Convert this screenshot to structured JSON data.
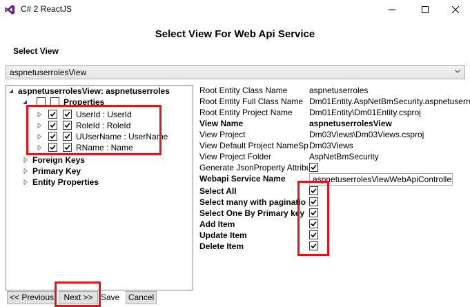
{
  "window": {
    "title": "C# 2 ReactJS",
    "minimize_icon": "minimize-icon",
    "maximize_icon": "maximize-icon",
    "close_icon": "close-icon"
  },
  "heading": "Select View For Web Api Service",
  "select_view": {
    "label": "Select View",
    "selected": "aspnetuserrolesView"
  },
  "tree": {
    "root_label": "aspnetuserrolesView: aspnetuserroles",
    "properties_label": "Properties",
    "properties_checked": false,
    "items": [
      {
        "label": "UserId : UserId",
        "checked": true
      },
      {
        "label": "RoleId : RoleId",
        "checked": true
      },
      {
        "label": "UUserName : UserName",
        "checked": true
      },
      {
        "label": "RName : Name",
        "checked": true
      }
    ],
    "groups": [
      "Foreign Keys",
      "Primary Key",
      "Entity Properties"
    ]
  },
  "details": {
    "root_entity_class_name": {
      "label": "Root Entity Class Name",
      "value": "aspnetuserroles"
    },
    "root_entity_full_class_name": {
      "label": "Root Entity Full Class Name",
      "value": "Dm01Entity.AspNetBmSecurity.aspnetuserro"
    },
    "root_entity_project_name": {
      "label": "Root Entity Project Name",
      "value": "Dm01Entity\\Dm01Entity.csproj"
    },
    "view_name": {
      "label": "View Name",
      "value": "aspnetuserrolesView"
    },
    "view_project": {
      "label": "View Project",
      "value": "Dm03Views\\Dm03Views.csproj"
    },
    "view_default_project_namespace": {
      "label": "View Default Project NameSpa",
      "value": "Dm03Views"
    },
    "view_project_folder": {
      "label": "View Project Folder",
      "value": "AspNetBmSecurity"
    },
    "generate_json_property": {
      "label": "Generate JsonProperty Attribu",
      "checked": true
    },
    "webapi_service_name": {
      "label": "Webapi Service Name",
      "value": "aspnetuserrolesViewWebApiController"
    }
  },
  "options": [
    {
      "label": "Select All",
      "checked": true
    },
    {
      "label": "Select many with paginatio",
      "checked": true
    },
    {
      "label": "Select One By Primary key",
      "checked": true
    },
    {
      "label": "Add Item",
      "checked": true
    },
    {
      "label": "Update Item",
      "checked": true
    },
    {
      "label": "Delete Item",
      "checked": true
    }
  ],
  "footer": {
    "previous": "<< Previous",
    "next": "Next >>",
    "save": "Save",
    "cancel": "Cancel"
  },
  "colors": {
    "highlight_red": "#e3141b",
    "vs_purple": "#68217a"
  }
}
